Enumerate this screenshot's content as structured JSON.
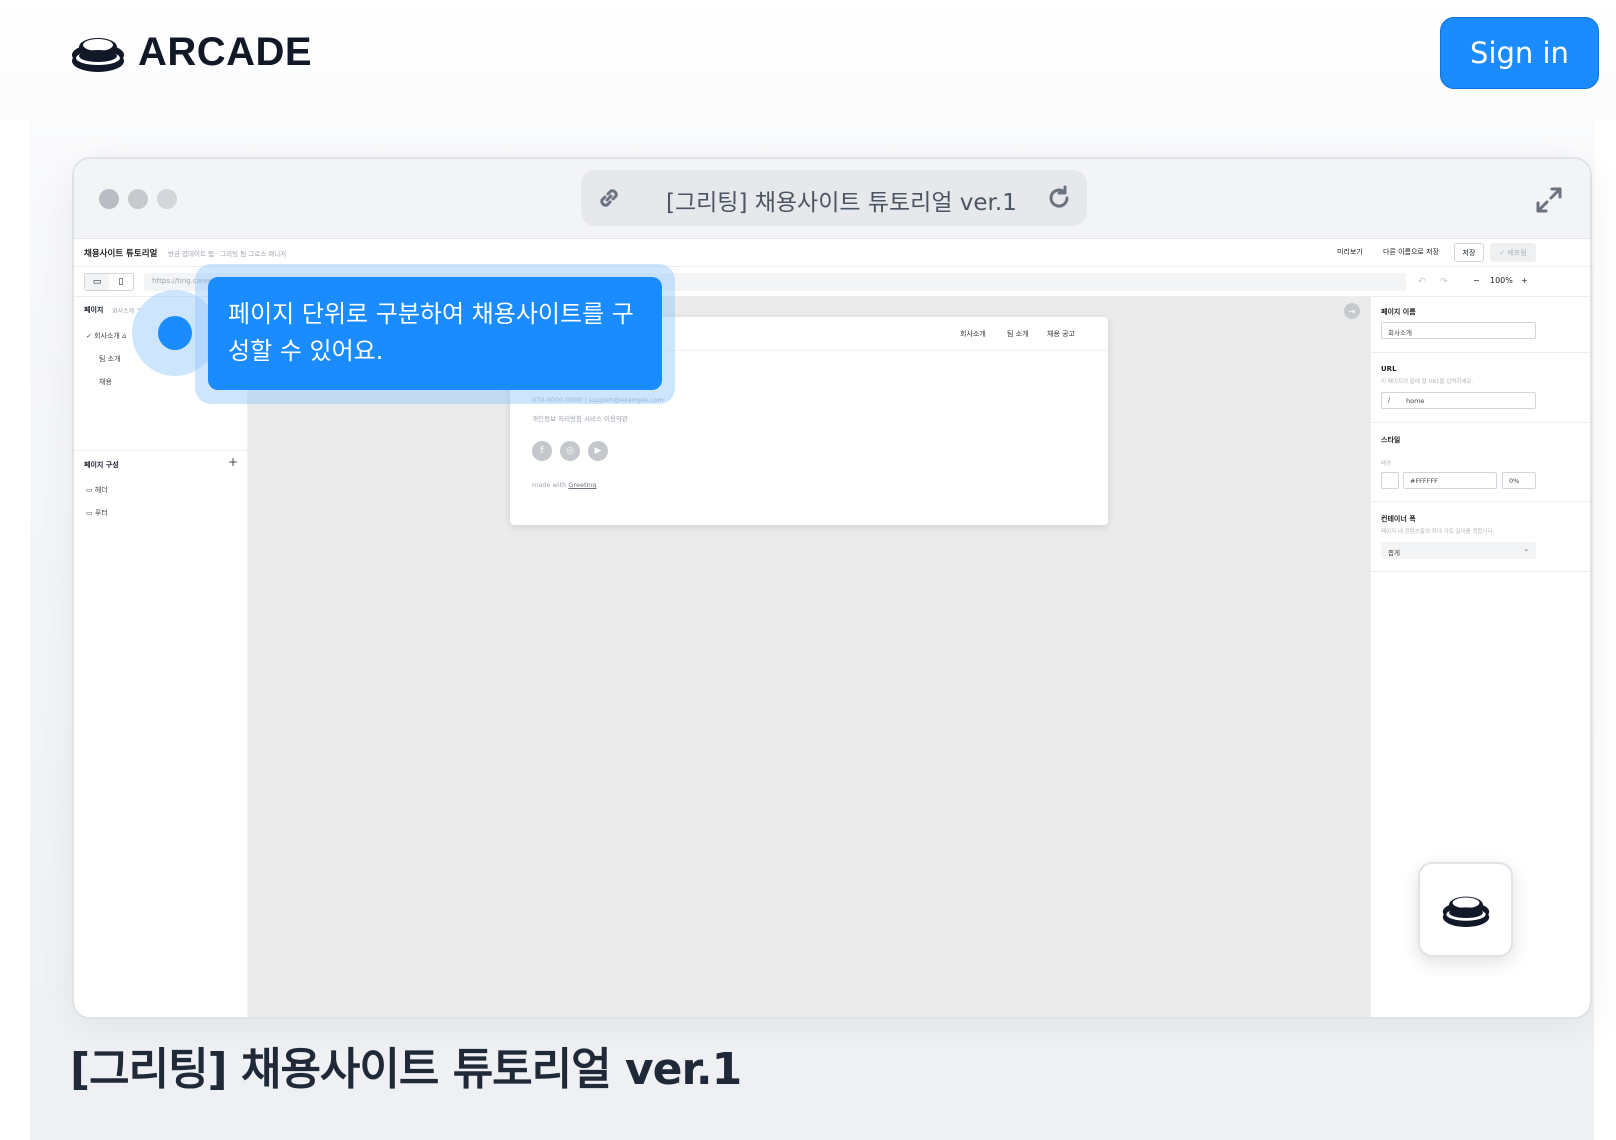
{
  "brand": {
    "name": "ARCADE",
    "logo_icon": "arcade-button-icon"
  },
  "header": {
    "signin_label": "Sign in",
    "accent": "#1a8cff"
  },
  "browser": {
    "title": "[그리팅] 채용사이트 튜토리얼 ver.1",
    "link_icon": "link-icon",
    "reload_icon": "reload-icon",
    "expand_icon": "expand-icon"
  },
  "app": {
    "title": "채용사이트 튜토리얼",
    "breadcrumb": "방금 업데이트 됨 · 그리팅 팀 그로스 매니저",
    "top_actions": {
      "preview": "미리보기",
      "save_as": "다른 이름으로 저장",
      "save": "저장",
      "publish": "✓ 배포됨"
    },
    "url": "https://ting.career.greetinghr.com/home",
    "zoom": "100%",
    "zoom_minus": "−",
    "zoom_plus": "+",
    "left_panel": {
      "pages_heading": "페이지",
      "pages_current": "회사소개 ^",
      "pages": [
        "✓  회사소개  ⌂",
        "팀 소개",
        "채용"
      ],
      "composition_heading": "페이지 구성",
      "add": "+",
      "sections": [
        "▭  헤더",
        "▭  푸터"
      ]
    },
    "preview": {
      "nav": [
        "회사소개",
        "팀 소개",
        "채용 공고"
      ],
      "contact": "070-0000-0000 | support@example.com",
      "links": "개인정보 처리방침     서비스 이용약관",
      "social": [
        "f",
        "◎",
        "▶"
      ],
      "made_with": "made with",
      "made_with_link": "Greeting"
    },
    "right_panel": {
      "page_name_label": "페이지 이름",
      "page_name_value": "회사소개",
      "url_label": "URL",
      "url_hint": "이 페이지의 끝에 될 URL을 입력하세요.",
      "url_prefix": "/",
      "url_value": "home",
      "style_label": "스타일",
      "bg_label": "배경",
      "bg_color": "#FFFFFF",
      "bg_opacity": "0%",
      "container_label": "컨테이너 폭",
      "container_hint": "페이지 내 콘텐츠들의 최대 가로 길이를 정합니다.",
      "container_value": "좁게",
      "container_chevron": "⌄"
    }
  },
  "tooltip": {
    "text": "페이지 단위로 구분하여 채용사이트를 구성할 수 있어요."
  },
  "footer": {
    "title": "[그리팅] 채용사이트 튜토리얼 ver.1"
  }
}
